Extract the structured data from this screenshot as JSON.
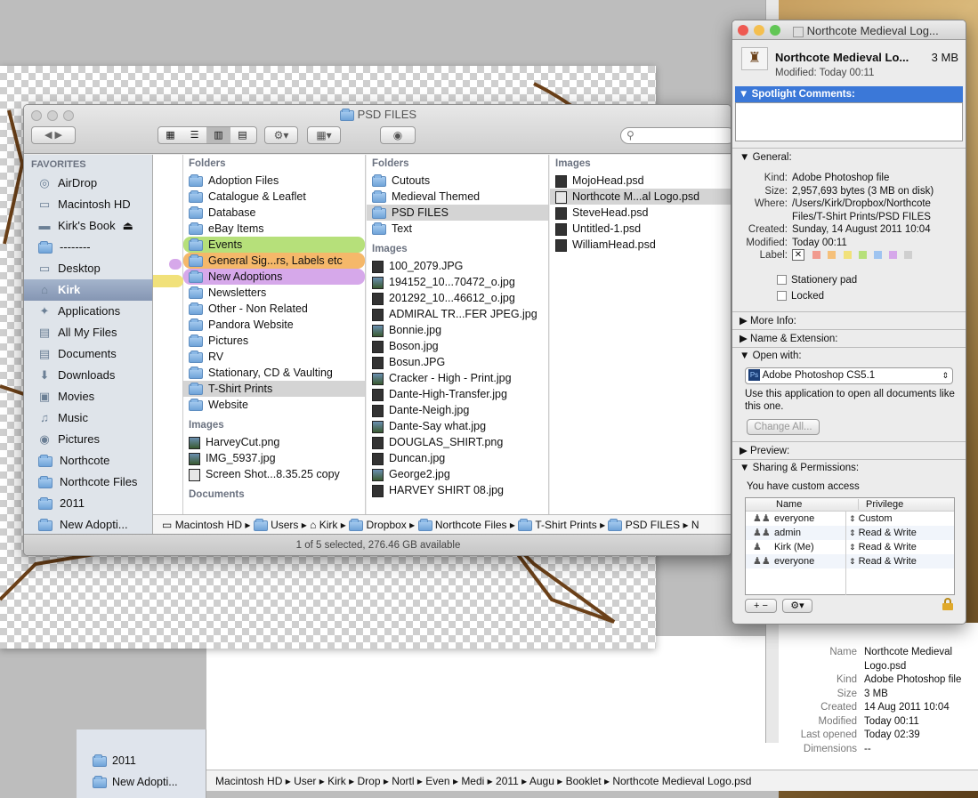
{
  "finder": {
    "title": "PSD FILES",
    "status": "1 of 5 selected, 276.46 GB available",
    "sidebar_heading": "FAVORITES",
    "sidebar": [
      "AirDrop",
      "Macintosh HD",
      "Kirk's Book",
      "--------",
      "Desktop",
      "Kirk",
      "Applications",
      "All My Files",
      "Documents",
      "Downloads",
      "Movies",
      "Music",
      "Pictures",
      "Northcote",
      "Northcote Files",
      "2011",
      "New Adopti..."
    ],
    "col1": {
      "head": "Folders",
      "folders": [
        "Adoption Files",
        "Catalogue & Leaflet",
        "Database",
        "eBay Items",
        "Events",
        "General Sig...rs, Labels etc",
        "New Adoptions",
        "Newsletters",
        "Other - Non Related",
        "Pandora Website",
        "Pictures",
        "RV",
        "Stationary, CD & Vaulting",
        "T-Shirt Prints",
        "Website"
      ],
      "images_head": "Images",
      "images": [
        "HarveyCut.png",
        "IMG_5937.jpg",
        "Screen Shot...8.35.25 copy"
      ],
      "docs_head": "Documents"
    },
    "col2": {
      "head": "Folders",
      "folders": [
        "Cutouts",
        "Medieval Themed",
        "PSD FILES",
        "Text"
      ],
      "images_head": "Images",
      "images": [
        "100_2079.JPG",
        "194152_10...70472_o.jpg",
        "201292_10...46612_o.jpg",
        "ADMIRAL TR...FER JPEG.jpg",
        "Bonnie.jpg",
        "Boson.jpg",
        "Bosun.JPG",
        "Cracker - High - Print.jpg",
        "Dante-High-Transfer.jpg",
        "Dante-Neigh.jpg",
        "Dante-Say what.jpg",
        "DOUGLAS_SHIRT.png",
        "Duncan.jpg",
        "George2.jpg",
        "HARVEY SHIRT 08.jpg"
      ]
    },
    "col3": {
      "head": "Images",
      "images": [
        "MojoHead.psd",
        "Northcote M...al Logo.psd",
        "SteveHead.psd",
        "Untitled-1.psd",
        "WilliamHead.psd"
      ]
    },
    "path": [
      "Macintosh HD",
      "Users",
      "Kirk",
      "Dropbox",
      "Northcote Files",
      "T-Shirt Prints",
      "PSD FILES",
      "N"
    ]
  },
  "back_window": {
    "sidebar": [
      "2011",
      "New Adopti..."
    ],
    "path": [
      "Macintosh HD",
      "User",
      "Kirk",
      "Drop",
      "Nortl",
      "Even",
      "Medi",
      "2011",
      "Augu",
      "Booklet",
      "Northcote Medieval Logo.psd"
    ],
    "info_labels": [
      "Name",
      "",
      "Kind",
      "Size",
      "Created",
      "Modified",
      "Last opened",
      "Dimensions"
    ],
    "info_values": [
      "Northcote Medieval",
      "Logo.psd",
      "Adobe Photoshop file",
      "3 MB",
      "14 Aug 2011 10:04",
      "Today 00:11",
      "Today 02:39",
      "--"
    ]
  },
  "info": {
    "title": "Northcote Medieval Log...",
    "name": "Northcote Medieval Lo...",
    "size": "3 MB",
    "modified": "Modified: Today 00:11",
    "spotlight": "Spotlight Comments:",
    "general": "General:",
    "labels": [
      "Kind:",
      "Size:",
      "Where:",
      "",
      "",
      "Created:",
      "Modified:",
      "Label:"
    ],
    "values": [
      "Adobe Photoshop file",
      "2,957,693 bytes (3 MB on disk)",
      "/Users/Kirk/Dropbox/Northcote",
      "Files/T-Shirt Prints/PSD FILES",
      "",
      "Sunday, 14 August 2011 10:04",
      "Today 00:11",
      ""
    ],
    "stationery": "Stationery pad",
    "locked": "Locked",
    "more_info": "More Info:",
    "name_ext": "Name & Extension:",
    "open_with": "Open with:",
    "app": "Adobe Photoshop CS5.1",
    "use_text": "Use this application to open all documents like this one.",
    "change_all": "Change All...",
    "preview": "Preview:",
    "sharing": "Sharing & Permissions:",
    "custom_access": "You have custom access",
    "perm_head": [
      "Name",
      "Privilege"
    ],
    "perms": [
      {
        "name": "everyone",
        "priv": "Custom"
      },
      {
        "name": "admin",
        "priv": "Read & Write"
      },
      {
        "name": "Kirk (Me)",
        "priv": "Read & Write"
      },
      {
        "name": "everyone",
        "priv": "Read & Write"
      }
    ]
  },
  "colors": {
    "events": "#b6e07a",
    "general": "#f5b86a",
    "new_adoptions": "#d6a8ea",
    "selection_blue": "#3b78d8"
  }
}
